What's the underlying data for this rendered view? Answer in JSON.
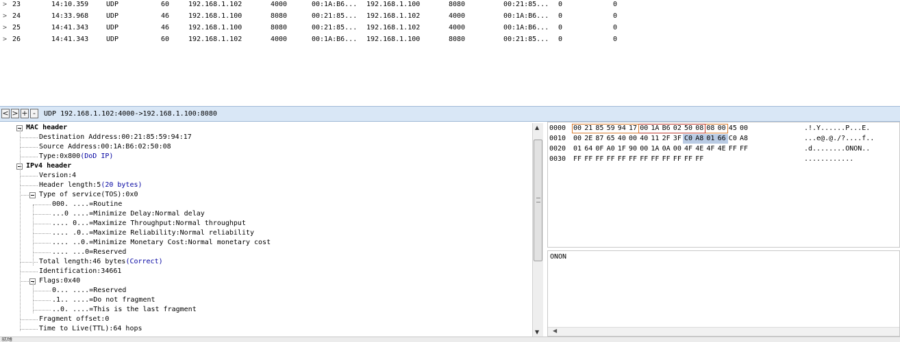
{
  "packets": [
    {
      "expander": ">",
      "no": "23",
      "time": "14:10.359",
      "proto": "UDP",
      "len": "60",
      "src_ip": "192.168.1.102",
      "src_port": "4000",
      "src_mac": "00:1A:B6...",
      "dst_ip": "192.168.1.100",
      "dst_port": "8080",
      "dst_mac": "00:21:85...",
      "c1": "0",
      "c2": "0"
    },
    {
      "expander": ">",
      "no": "24",
      "time": "14:33.968",
      "proto": "UDP",
      "len": "46",
      "src_ip": "192.168.1.100",
      "src_port": "8080",
      "src_mac": "00:21:85...",
      "dst_ip": "192.168.1.102",
      "dst_port": "4000",
      "dst_mac": "00:1A:B6...",
      "c1": "0",
      "c2": "0"
    },
    {
      "expander": ">",
      "no": "25",
      "time": "14:41.343",
      "proto": "UDP",
      "len": "46",
      "src_ip": "192.168.1.100",
      "src_port": "8080",
      "src_mac": "00:21:85...",
      "dst_ip": "192.168.1.102",
      "dst_port": "4000",
      "dst_mac": "00:1A:B6...",
      "c1": "0",
      "c2": "0"
    },
    {
      "expander": ">",
      "no": "26",
      "time": "14:41.343",
      "proto": "UDP",
      "len": "60",
      "src_ip": "192.168.1.102",
      "src_port": "4000",
      "src_mac": "00:1A:B6...",
      "dst_ip": "192.168.1.100",
      "dst_port": "8080",
      "dst_mac": "00:21:85...",
      "c1": "0",
      "c2": "0"
    }
  ],
  "toolbar": {
    "back": "<",
    "forward": ">",
    "expand": "+",
    "collapse": "-",
    "label": "UDP 192.168.1.102:4000->192.168.1.100:8080"
  },
  "tree": [
    {
      "text": "MAC header",
      "bold": true,
      "box": true
    },
    {
      "text": "Destination Address:00:21:85:59:94:17"
    },
    {
      "text": "Source Address:00:1A:B6:02:50:08"
    },
    {
      "text": "Type:0x800",
      "suffix": "(DoD IP)"
    },
    {
      "text": "IPv4 header",
      "bold": true,
      "box": true
    },
    {
      "text": "Version:4"
    },
    {
      "text": "Header length:5",
      "suffix": "(20 bytes)"
    },
    {
      "text": "Type of service(TOS):0x0",
      "box": true
    },
    {
      "text": "000. ....=Routine"
    },
    {
      "text": "...0 ....=Minimize Delay:Normal delay"
    },
    {
      "text": ".... 0...=Maximize Throughput:Normal throughput"
    },
    {
      "text": ".... .0..=Maximize Reliability:Normal reliability"
    },
    {
      "text": ".... ..0.=Minimize Monetary Cost:Normal monetary cost"
    },
    {
      "text": ".... ...0=Reserved"
    },
    {
      "text": "Total length:46 bytes",
      "suffix": "(Correct)"
    },
    {
      "text": "Identification:34661"
    },
    {
      "text": "Flags:0x40",
      "box": true
    },
    {
      "text": "0... ....=Reserved"
    },
    {
      "text": ".1.. ....=Do not fragment"
    },
    {
      "text": "..0. ....=This is the last fragment"
    },
    {
      "text": "Fragment offset:0"
    },
    {
      "text": "Time to Live(TTL):64 hops"
    }
  ],
  "tree_scroll": {
    "up": "▲",
    "down": "▼"
  },
  "hex": [
    {
      "offset": "0000",
      "bytes": [
        "00",
        "21",
        "85",
        "59",
        "94",
        "17",
        "00",
        "1A",
        "B6",
        "02",
        "50",
        "08",
        "08",
        "00",
        "45",
        "00"
      ],
      "ascii": ".!.Y......P...E."
    },
    {
      "offset": "0010",
      "bytes": [
        "00",
        "2E",
        "87",
        "65",
        "40",
        "00",
        "40",
        "11",
        "2F",
        "3F",
        "C0",
        "A8",
        "01",
        "66",
        "C0",
        "A8"
      ],
      "ascii": "...e@.@./?....f.."
    },
    {
      "offset": "0020",
      "bytes": [
        "01",
        "64",
        "0F",
        "A0",
        "1F",
        "90",
        "00",
        "1A",
        "0A",
        "00",
        "4F",
        "4E",
        "4F",
        "4E",
        "FF",
        "FF"
      ],
      "ascii": ".d........ONON.."
    },
    {
      "offset": "0030",
      "bytes": [
        "FF",
        "FF",
        "FF",
        "FF",
        "FF",
        "FF",
        "FF",
        "FF",
        "FF",
        "FF",
        "FF",
        "FF"
      ],
      "ascii": "............"
    }
  ],
  "highlight_colors": {
    "dst_mac": "#d97a2b",
    "src_mac": "#c0392b",
    "type": "#d97a2b",
    "ip_sel_fill": "#b9cbe4"
  },
  "text_pane": {
    "content": "ONON",
    "scroll_left": "◀"
  },
  "status": {
    "text": "就绪"
  }
}
